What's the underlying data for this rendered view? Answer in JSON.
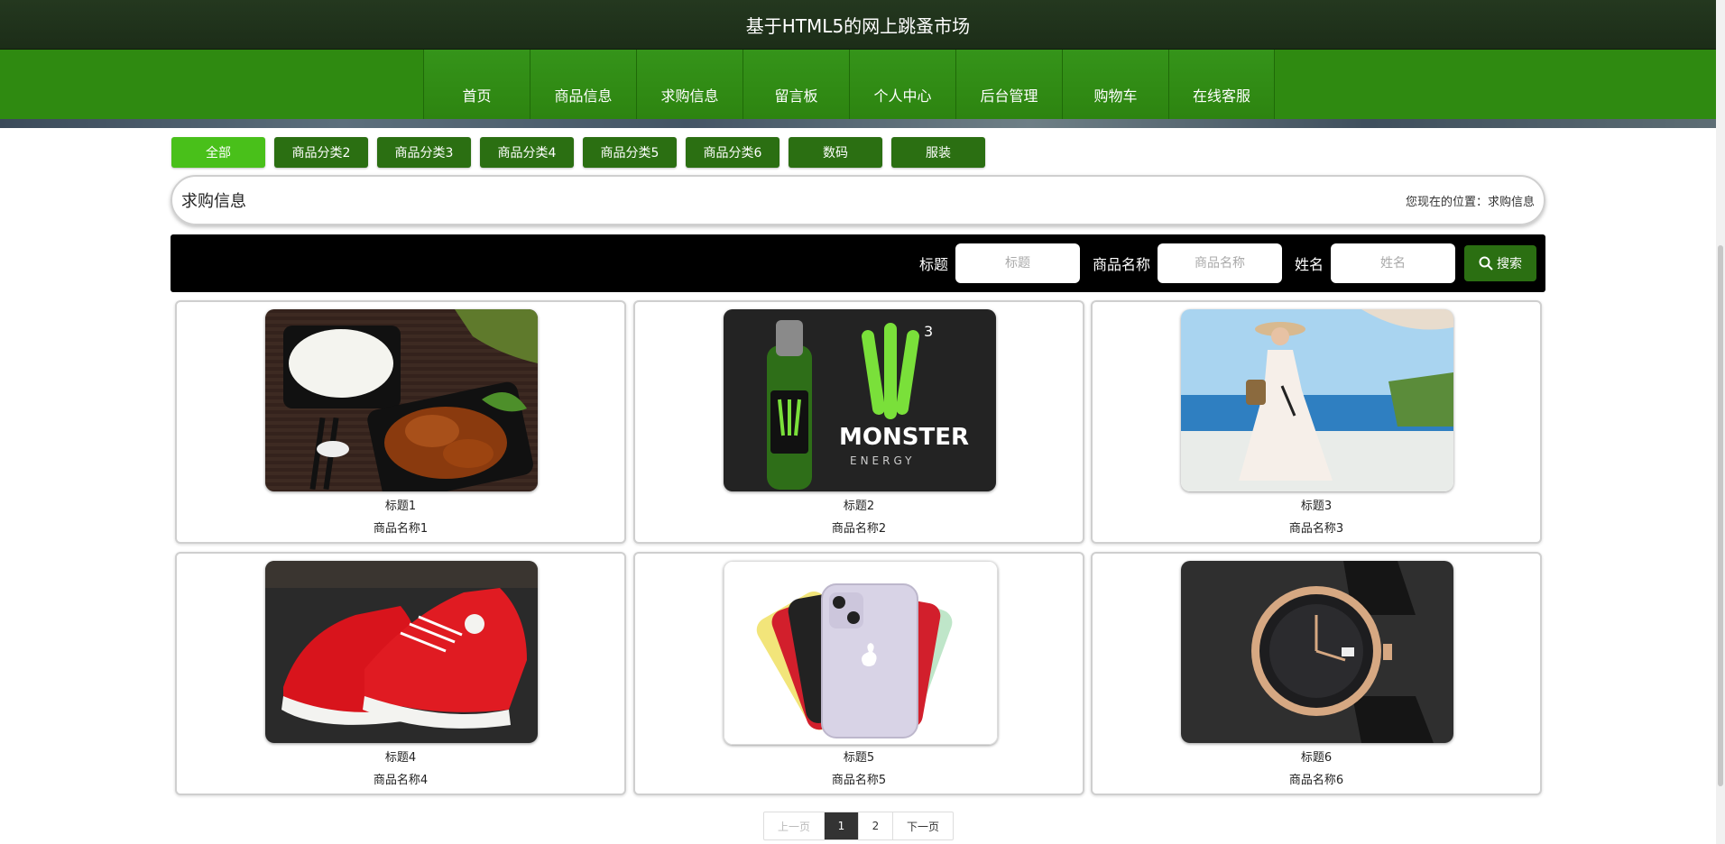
{
  "site_title": "基于HTML5的网上跳蚤市场",
  "nav": [
    "首页",
    "商品信息",
    "求购信息",
    "留言板",
    "个人中心",
    "后台管理",
    "购物车",
    "在线客服"
  ],
  "categories": [
    "全部",
    "商品分类2",
    "商品分类3",
    "商品分类4",
    "商品分类5",
    "商品分类6",
    "数码",
    "服装"
  ],
  "location": {
    "heading": "求购信息",
    "breadcrumb": "您现在的位置：求购信息"
  },
  "search": {
    "fields": [
      {
        "label": "标题",
        "placeholder": "标题"
      },
      {
        "label": "商品名称",
        "placeholder": "商品名称"
      },
      {
        "label": "姓名",
        "placeholder": "姓名"
      }
    ],
    "button": "搜索"
  },
  "cards": [
    {
      "title": "标题1",
      "name": "商品名称1",
      "image": "food-bento"
    },
    {
      "title": "标题2",
      "name": "商品名称2",
      "image": "monster-energy-drink"
    },
    {
      "title": "标题3",
      "name": "商品名称3",
      "image": "white-dress-beach"
    },
    {
      "title": "标题4",
      "name": "商品名称4",
      "image": "red-sneakers"
    },
    {
      "title": "标题5",
      "name": "商品名称5",
      "image": "phone-colors"
    },
    {
      "title": "标题6",
      "name": "商品名称6",
      "image": "wristwatch"
    }
  ],
  "monster_text": "MONSTER",
  "monster_sub": "ENERGY",
  "pagination": {
    "prev": "上一页",
    "pages": [
      "1",
      "2"
    ],
    "current": "1",
    "next": "下一页"
  },
  "colors": {
    "nav_green": "#2f8a11",
    "header_dark": "#24381f",
    "button_green": "#2b6f12",
    "active_green": "#49c01a"
  }
}
